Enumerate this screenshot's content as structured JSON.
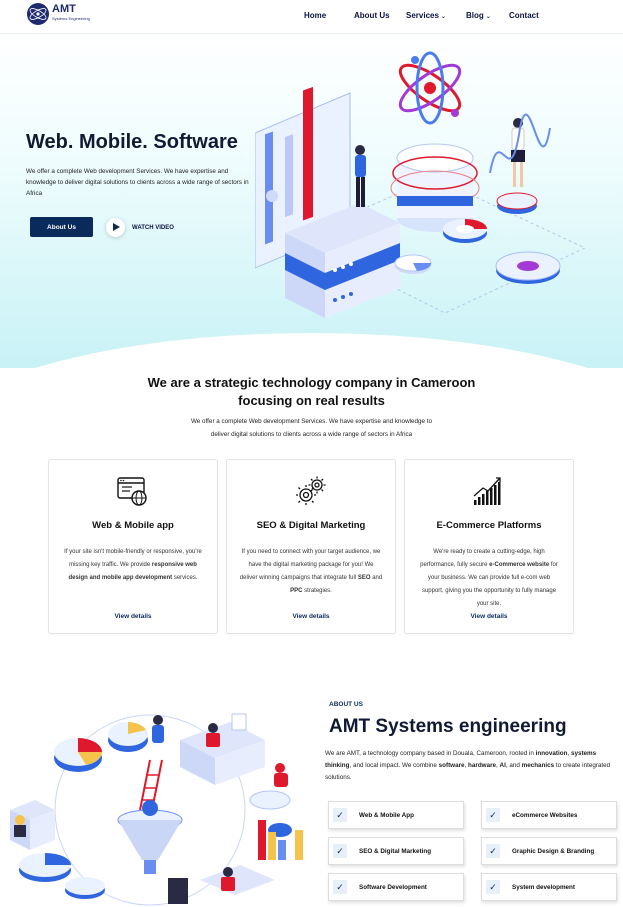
{
  "brand": {
    "name": "AMT",
    "tagline": "Systems Engineering"
  },
  "nav": {
    "items": [
      {
        "label": "Home",
        "has_dropdown": false
      },
      {
        "label": "About Us",
        "has_dropdown": false
      },
      {
        "label": "Services",
        "has_dropdown": true
      },
      {
        "label": "Blog",
        "has_dropdown": true
      },
      {
        "label": "Contact",
        "has_dropdown": false
      }
    ]
  },
  "hero": {
    "title": "Web. Mobile. Software",
    "description": "We offer a complete Web development Services. We have expertise and knowledge to deliver digital solutions to clients across a wide range of sectors in Africa",
    "primary_button": "About Us",
    "video_label": "WATCH VIDEO"
  },
  "intro": {
    "title_line1": "We are a strategic technology company in Cameroon",
    "title_line2": "focusing on real results",
    "desc_line1": "We offer a complete Web development Services. We have expertise and knowledge to",
    "desc_line2": "deliver digital solutions to clients across a wide range of sectors in Africa"
  },
  "services": [
    {
      "icon": "browser-globe-icon",
      "title": "Web & Mobile app",
      "text_parts": [
        "If your site isn't mobile-friendly or responsive, you're missing key traffic. We provide ",
        "responsive web design and mobile app development",
        " services."
      ],
      "link": "View details"
    },
    {
      "icon": "gears-icon",
      "title": "SEO & Digital Marketing",
      "text_parts": [
        "If you need to connect with your target audience, we have the digital marketing package for you! We deliver winning campaigns that integrate full ",
        "SEO",
        " and ",
        "PPC",
        " strategies."
      ],
      "link": "View details"
    },
    {
      "icon": "growth-chart-icon",
      "title": "E-Commerce Platforms",
      "text_parts": [
        "We're ready to create a cutting-edge, high performance, fully secure ",
        "e-Commerce website",
        " for your business. We can provide full e-com web support, giving you the opportunity to fully manage your site."
      ],
      "link": "View details"
    }
  ],
  "about": {
    "kicker": "ABOUT US",
    "title": "AMT Systems engineering",
    "desc_parts": [
      "We are AMT, a technology company based in Douala, Cameroon, rooted in ",
      "innovation",
      ", ",
      "systems thinking",
      ", and local impact. We combine ",
      "software",
      ", ",
      "hardware",
      ", ",
      "AI",
      ", and ",
      "mechanics",
      " to create integrated solutions."
    ],
    "features": [
      "Web & Mobile App",
      "eCommerce Websites",
      "SEO & Digital Marketing",
      "Graphic Design & Branding",
      "Software Development",
      "System development"
    ]
  },
  "colors": {
    "primary": "#0b2a5c",
    "accent": "#e0182d",
    "hero_bg": "#c8f2f6"
  }
}
